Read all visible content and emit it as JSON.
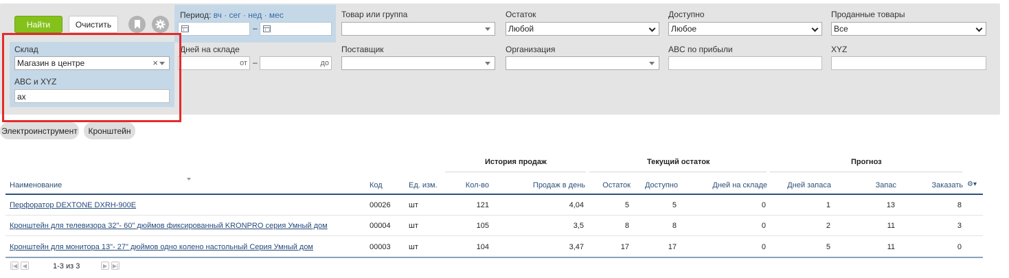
{
  "toolbar": {
    "find_label": "Найти",
    "clear_label": "Очистить"
  },
  "filters": {
    "period": {
      "label": "Период:",
      "links": "вч · сег · нед · мес",
      "dash": "–"
    },
    "product": {
      "label": "Товар или группа",
      "value": ""
    },
    "balance": {
      "label": "Остаток",
      "value": "Любой"
    },
    "available": {
      "label": "Доступно",
      "value": "Любое"
    },
    "sold": {
      "label": "Проданные товары",
      "value": "Все"
    },
    "days_in_stock": {
      "label": "Дней на складе",
      "from": "от",
      "to": "до",
      "dash": "–"
    },
    "supplier": {
      "label": "Поставщик",
      "value": ""
    },
    "organization": {
      "label": "Организация",
      "value": ""
    },
    "abc_profit": {
      "label": "ABC по прибыли",
      "value": ""
    },
    "xyz": {
      "label": "XYZ",
      "value": ""
    },
    "warehouse": {
      "label": "Склад",
      "value": "Магазин в центре",
      "clear_symbol": "×"
    },
    "abc_xyz": {
      "label": "ABC и XYZ",
      "value": "ax"
    }
  },
  "tags": [
    "Электроинструмент",
    "Кронштейн"
  ],
  "table": {
    "groups": {
      "sales_history": "История продаж",
      "current_stock": "Текущий остаток",
      "forecast": "Прогноз"
    },
    "columns": {
      "name": "Наименование",
      "code": "Код",
      "unit": "Ед. изм.",
      "qty": "Кол-во",
      "sales_per_day": "Продаж в день",
      "balance": "Остаток",
      "available": "Доступно",
      "days_in_stock": "Дней на складе",
      "days_supply": "Дней запаса",
      "stock": "Запас",
      "order": "Заказать"
    },
    "rows": [
      {
        "name": "Перфоратор DEXTONE DXRH-900E",
        "code": "00026",
        "unit": "шт",
        "qty": "121",
        "sales_per_day": "4,04",
        "balance": "5",
        "available": "5",
        "days_in_stock": "0",
        "days_supply": "1",
        "stock": "13",
        "order": "8"
      },
      {
        "name": "Кронштейн для телевизора 32\"- 60\" дюймов фиксированный KRONPRO серия Умный дом",
        "code": "00004",
        "unit": "шт",
        "qty": "105",
        "sales_per_day": "3,5",
        "balance": "8",
        "available": "8",
        "days_in_stock": "0",
        "days_supply": "2",
        "stock": "11",
        "order": "3"
      },
      {
        "name": "Кронштейн для монитора 13\"- 27\" дюймов одно колено настольный Серия Умный дом",
        "code": "00003",
        "unit": "шт",
        "qty": "104",
        "sales_per_day": "3,47",
        "balance": "17",
        "available": "17",
        "days_in_stock": "0",
        "days_supply": "5",
        "stock": "11",
        "order": "0"
      }
    ]
  },
  "pagination": {
    "summary": "1-3 из 3"
  },
  "colors": {
    "accent_green": "#84c21b",
    "panel_blue": "#c5d8e8",
    "highlight_red": "#e52a2a",
    "link_blue": "#254a7c"
  }
}
